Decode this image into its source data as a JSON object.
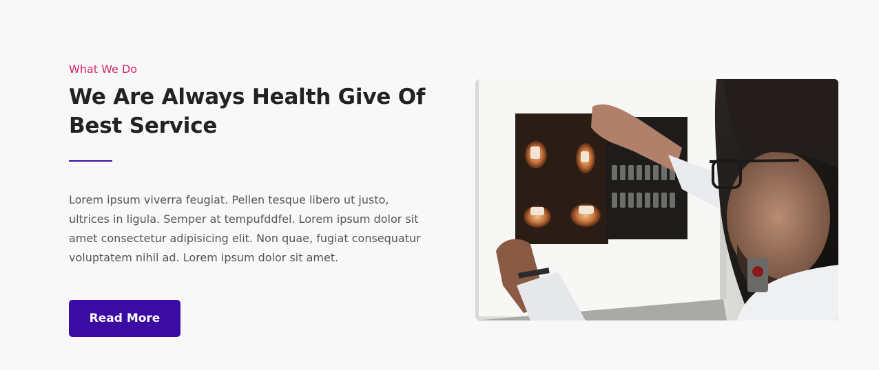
{
  "about": {
    "eyebrow": "What We Do",
    "heading": "We Are Always Health Give Of Best Service",
    "body": "Lorem ipsum viverra feugiat. Pellen tesque libero ut justo, ultrices in ligula. Semper at tempufddfel. Lorem ipsum dolor sit amet consectetur adipisicing elit. Non quae, fugiat consequatur voluptatem nihil ad. Lorem ipsum dolor sit amet.",
    "button_label": "Read More"
  },
  "colors": {
    "accent": "#3a0ca3",
    "eyebrow": "#d6246e",
    "heading": "#222222",
    "body_text": "#555555",
    "background": "#f8f8f9"
  },
  "image": {
    "subject": "doctor-examining-dental-xray-icon"
  }
}
